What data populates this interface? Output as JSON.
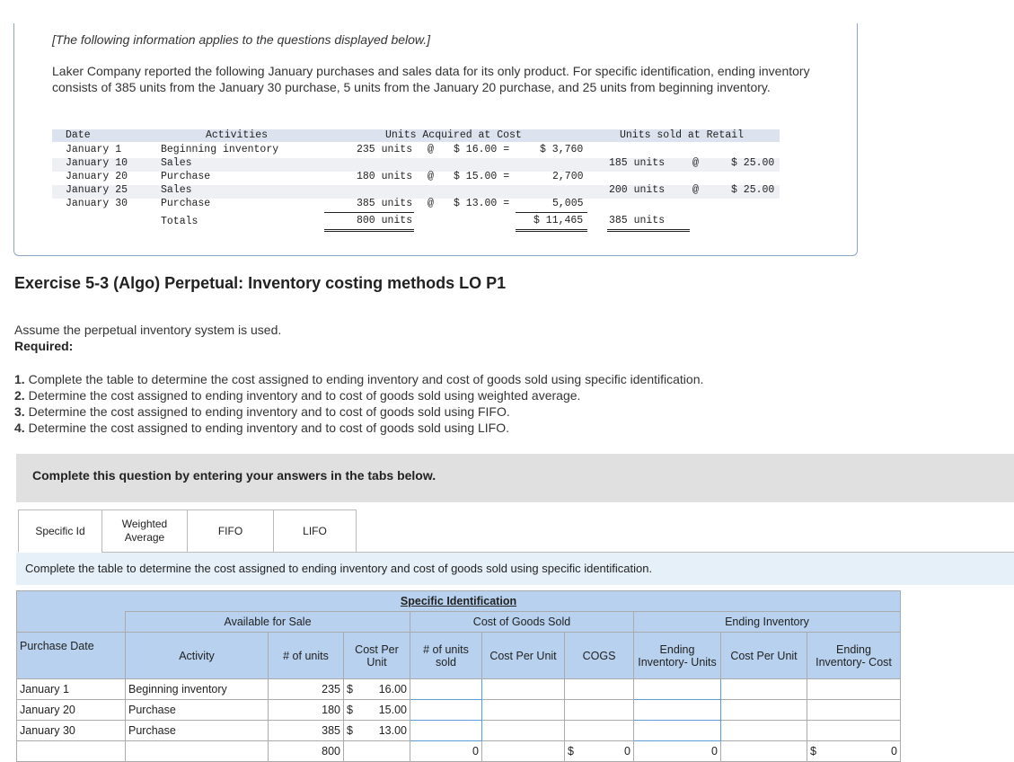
{
  "note": "[The following information applies to the questions displayed below.]",
  "intro": "Laker Company reported the following January purchases and sales data for its only product. For specific identification, ending inventory consists of 385 units from the January 30 purchase, 5 units from the January 20 purchase, and 25 units from beginning inventory.",
  "data_table": {
    "headers": {
      "date": "Date",
      "activities": "Activities",
      "acquired": "Units Acquired at Cost",
      "sold": "Units sold at Retail"
    },
    "rows": [
      {
        "date": "January 1",
        "activity": "Beginning inventory",
        "units": "235 units",
        "at": "@",
        "cost": "$ 16.00 =",
        "total": "$ 3,760",
        "sold_units": "",
        "sold_at": "",
        "retail": ""
      },
      {
        "date": "January 10",
        "activity": "Sales",
        "units": "",
        "at": "",
        "cost": "",
        "total": "",
        "sold_units": "185 units",
        "sold_at": "@",
        "retail": "$ 25.00"
      },
      {
        "date": "January 20",
        "activity": "Purchase",
        "units": "180 units",
        "at": "@",
        "cost": "$ 15.00 =",
        "total": "2,700",
        "sold_units": "",
        "sold_at": "",
        "retail": ""
      },
      {
        "date": "January 25",
        "activity": "Sales",
        "units": "",
        "at": "",
        "cost": "",
        "total": "",
        "sold_units": "200 units",
        "sold_at": "@",
        "retail": "$ 25.00"
      },
      {
        "date": "January 30",
        "activity": "Purchase",
        "units": "385 units",
        "at": "@",
        "cost": "$ 13.00 =",
        "total": "5,005",
        "sold_units": "",
        "sold_at": "",
        "retail": ""
      }
    ],
    "totals": {
      "label": "Totals",
      "units": "800 units",
      "total": "$ 11,465",
      "sold_units": "385 units"
    }
  },
  "exercise_title": "Exercise 5-3 (Algo) Perpetual: Inventory costing methods LO P1",
  "assume": "Assume the perpetual inventory system is used.",
  "required": "Required:",
  "requirements": [
    {
      "num": "1.",
      "text": " Complete the table to determine the cost assigned to ending inventory and cost of goods sold using specific identification."
    },
    {
      "num": "2.",
      "text": " Determine the cost assigned to ending inventory and to cost of goods sold using weighted average."
    },
    {
      "num": "3.",
      "text": " Determine the cost assigned to ending inventory and to cost of goods sold using FIFO."
    },
    {
      "num": "4.",
      "text": " Determine the cost assigned to ending inventory and to cost of goods sold using LIFO."
    }
  ],
  "complete_bar": "Complete this question by entering your answers in the tabs below.",
  "tabs": [
    "Specific Id",
    "Weighted Average",
    "FIFO",
    "LIFO"
  ],
  "instruction": "Complete the table to determine the cost assigned to ending inventory and cost of goods sold using specific identification.",
  "grid": {
    "title": "Specific Identification",
    "group_available": "Available for Sale",
    "group_cogs": "Cost of Goods Sold",
    "group_ending": "Ending Inventory",
    "col_purchase_date": "Purchase Date",
    "col_activity": "Activity",
    "col_units": "# of units",
    "col_cost_per_unit": "Cost Per Unit",
    "col_units_sold": "# of units sold",
    "col_cogs_cpu": "Cost Per Unit",
    "col_cogs": "COGS",
    "col_end_units": "Ending Inventory- Units",
    "col_end_cpu": "Cost Per Unit",
    "col_end_cost": "Ending Inventory- Cost",
    "rows": [
      {
        "date": "January 1",
        "activity": "Beginning inventory",
        "units": "235",
        "dollar": "$",
        "cpu": "16.00"
      },
      {
        "date": "January 20",
        "activity": "Purchase",
        "units": "180",
        "dollar": "$",
        "cpu": "15.00"
      },
      {
        "date": "January 30",
        "activity": "Purchase",
        "units": "385",
        "dollar": "$",
        "cpu": "13.00"
      }
    ],
    "total_units": "800",
    "total_sold": "0",
    "total_cogs_dollar": "$",
    "total_cogs": "0",
    "total_end_units": "0",
    "total_end_dollar": "$",
    "total_end_cost": "0"
  }
}
